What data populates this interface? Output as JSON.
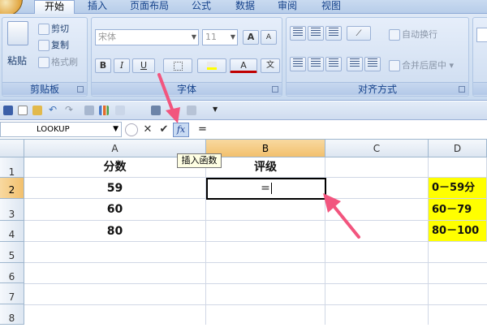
{
  "ribbon_tabs": [
    "开始",
    "插入",
    "页面布局",
    "公式",
    "数据",
    "审阅",
    "视图"
  ],
  "clipboard": {
    "paste": "粘贴",
    "cut": "剪切",
    "copy": "复制",
    "format_painter": "格式刷",
    "label": "剪贴板"
  },
  "font": {
    "name_placeholder": "宋体",
    "size_placeholder": "11",
    "label": "字体",
    "bold": "B",
    "italic": "I",
    "underline": "U",
    "grow": "A",
    "shrink": "A",
    "color": "A",
    "phonetic": "文"
  },
  "alignment": {
    "wrap": "自动换行",
    "merge": "合并后居中",
    "label": "对齐方式"
  },
  "formula_bar": {
    "name_box": "LOOKUP",
    "cancel": "✕",
    "enter": "✔",
    "fx": "fx",
    "content": "="
  },
  "tooltip": "插入函数",
  "columns": [
    "A",
    "B",
    "C",
    "D"
  ],
  "rows": [
    "1",
    "2",
    "3",
    "4",
    "5",
    "6",
    "7",
    "8"
  ],
  "cells": {
    "A1": "分数",
    "B1": "评级",
    "A2": "59",
    "A3": "60",
    "A4": "80",
    "B2": "=",
    "D2": "0－59分",
    "D3": "60－79",
    "D4": "80－100"
  },
  "colors": {
    "highlight": "#ffff00",
    "arrow": "#f2557e",
    "selected_header": "#f5c46f"
  }
}
